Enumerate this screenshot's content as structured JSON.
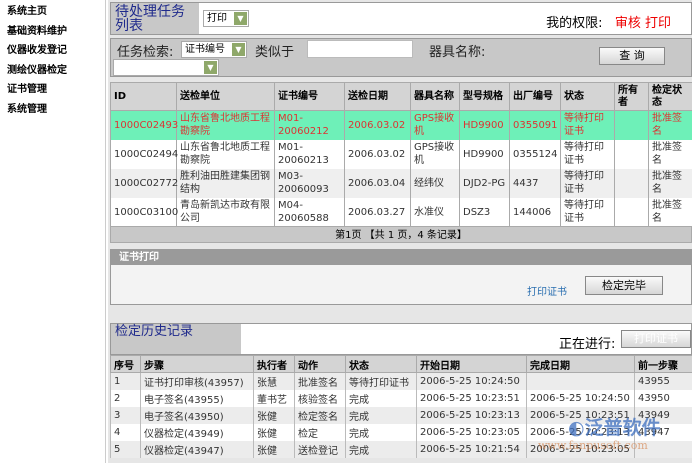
{
  "sidebar": {
    "items": [
      "系统主页",
      "基础资料维护",
      "仪器收发登记",
      "测绘仪器检定",
      "证书管理",
      "系统管理"
    ]
  },
  "header": {
    "title": "待处理任务列表",
    "task_type": "打印",
    "perm_label": "我的权限:",
    "perm_values": "审核 打印"
  },
  "search": {
    "label": "任务检索:",
    "field": "证书编号",
    "like_label": "类似于",
    "like_value": "",
    "instrument_label": "器具名称:",
    "instrument_value": "",
    "query_button": "查 询"
  },
  "tasks": {
    "columns": [
      "ID",
      "送检单位",
      "证书编号",
      "送检日期",
      "器具名称",
      "型号规格",
      "出厂编号",
      "状态",
      "所有者",
      "检定状态"
    ],
    "rows": [
      [
        "1000C02493",
        "山东省鲁北地质工程勘察院",
        "M01-20060212",
        "2006.03.02",
        "GPS接收机",
        "HD9900",
        "0355091",
        "等待打印证书",
        "",
        "批准签名"
      ],
      [
        "1000C02494",
        "山东省鲁北地质工程勘察院",
        "M01-20060213",
        "2006.03.02",
        "GPS接收机",
        "HD9900",
        "0355124",
        "等待打印证书",
        "",
        "批准签名"
      ],
      [
        "1000C02772",
        "胜利油田胜建集团钢结构",
        "M03-20060093",
        "2006.03.04",
        "经纬仪",
        "DJD2-PG",
        "4437",
        "等待打印证书",
        "",
        "批准签名"
      ],
      [
        "1000C03100",
        "青岛新凯达市政有限公司",
        "M04-20060588",
        "2006.03.27",
        "水准仪",
        "DSZ3",
        "144006",
        "等待打印证书",
        "",
        "批准签名"
      ]
    ],
    "pager": "第1页 【共 1 页，4 条记录】"
  },
  "print": {
    "title": "证书打印",
    "link": "打印证书",
    "finish_button": "检定完毕"
  },
  "history": {
    "title": "检定历史记录",
    "in_progress_label": "正在进行:",
    "in_progress_button": "打印证书",
    "columns": [
      "序号",
      "步骤",
      "执行者",
      "动作",
      "状态",
      "开始日期",
      "完成日期",
      "前一步骤"
    ],
    "rows": [
      [
        "1",
        "证书打印审核(43957)",
        "张慧",
        "批准签名",
        "等待打印证书",
        "2006-5-25 10:24:50",
        "",
        "43955"
      ],
      [
        "2",
        "电子签名(43955)",
        "董书艺",
        "核验签名",
        "完成",
        "2006-5-25 10:23:51",
        "2006-5-25 10:24:50",
        "43950"
      ],
      [
        "3",
        "电子签名(43950)",
        "张健",
        "检定签名",
        "完成",
        "2006-5-25 10:23:13",
        "2006-5-25 10:23:51",
        "43949"
      ],
      [
        "4",
        "仪器检定(43949)",
        "张健",
        "检定",
        "完成",
        "2006-5-25 10:23:05",
        "2006-5-25 10:23:13",
        "43947"
      ],
      [
        "5",
        "仪器检定(43947)",
        "张健",
        "送检登记",
        "完成",
        "2006-5-25 10:21:54",
        "2006-5-25 10:23:05",
        ""
      ]
    ]
  },
  "watermark": {
    "name": "泛普软件",
    "url": "www.fanpusoft.com"
  }
}
